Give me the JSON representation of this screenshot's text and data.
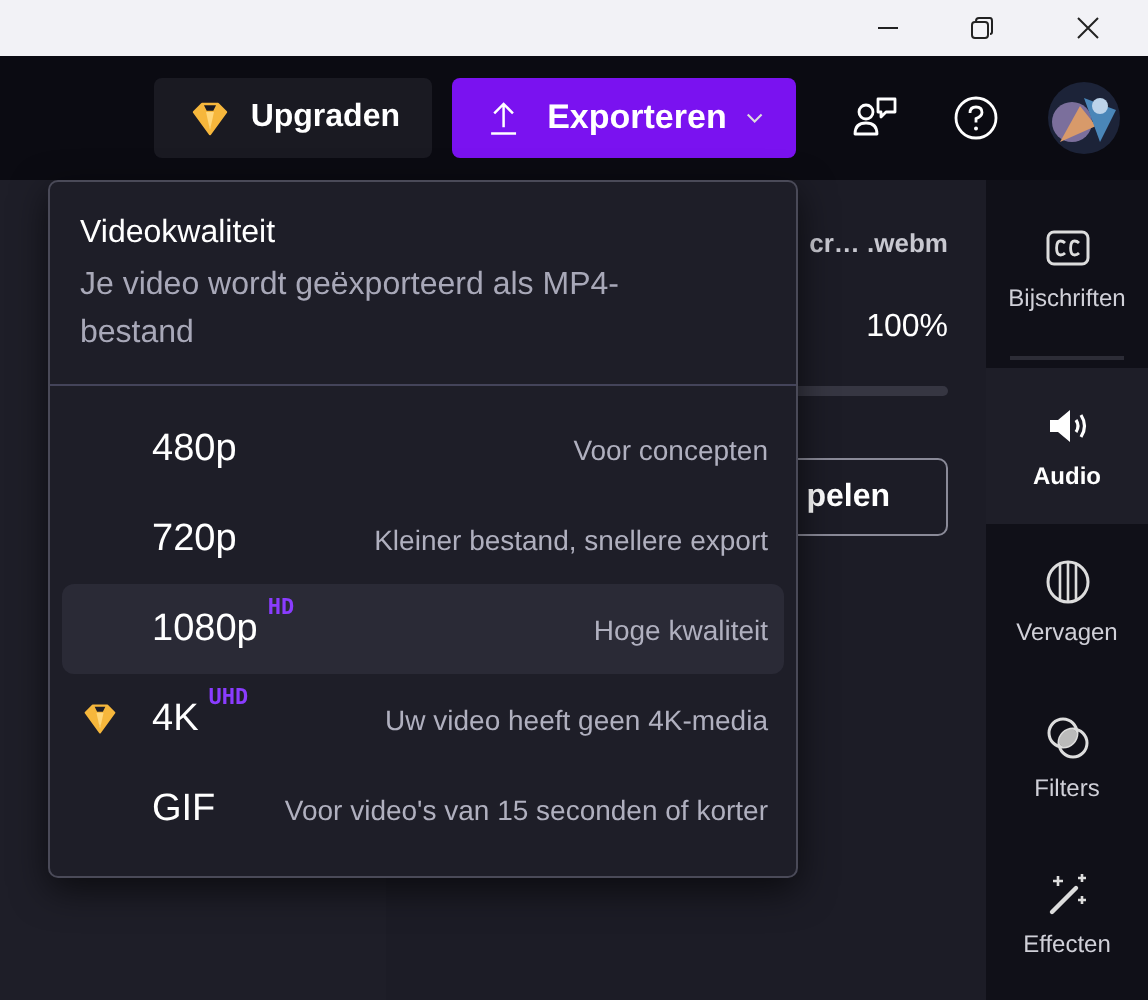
{
  "window_controls": [
    {
      "kind": "minimize"
    },
    {
      "kind": "restore"
    },
    {
      "kind": "close"
    }
  ],
  "toolbar": {
    "upgrade_button": "Upgraden",
    "export_button": "Exporteren"
  },
  "media_panel": {
    "file_name": "cr… .webm",
    "volume_reading": "100%",
    "button": "pelen"
  },
  "sidebar": {
    "items": [
      {
        "label": "Bijschriften",
        "kind": "captions",
        "selected": false
      },
      {
        "label": "Audio",
        "kind": "audio",
        "selected": true
      },
      {
        "label": "Vervagen",
        "kind": "blur",
        "selected": false
      },
      {
        "label": "Filters",
        "kind": "filters",
        "selected": false
      },
      {
        "label": "Effecten",
        "kind": "effects",
        "selected": false
      }
    ]
  },
  "quality_menu": {
    "title": "Videokwaliteit",
    "subtitle": "Je video wordt geëxporteerd als MP4-bestand",
    "options": [
      {
        "label": "480p",
        "description": "Voor concepten",
        "premium": false,
        "selected": false
      },
      {
        "label": "720p",
        "description": "Kleiner bestand, snellere export",
        "premium": false,
        "selected": false
      },
      {
        "label": "1080p",
        "badge": "HD",
        "description": "Hoge kwaliteit",
        "premium": false,
        "selected": true
      },
      {
        "label": "4K",
        "badge": "UHD",
        "description": "Uw video heeft geen 4K-media",
        "premium": true,
        "selected": false
      },
      {
        "label": "GIF",
        "description": "Voor video's van 15 seconden of korter",
        "premium": false,
        "selected": false
      }
    ]
  }
}
